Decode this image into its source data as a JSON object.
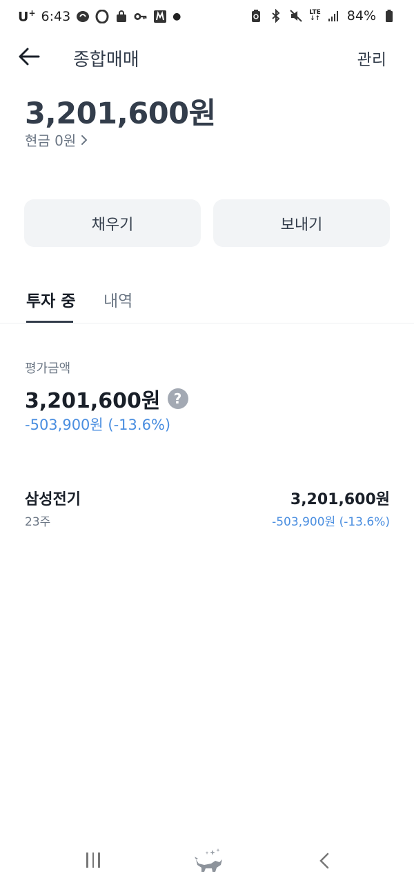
{
  "status_bar": {
    "carrier": "U",
    "carrier_sup": "+",
    "time": "6:43",
    "battery": "84%",
    "network": "LTE"
  },
  "header": {
    "title": "종합매매",
    "manage_label": "관리"
  },
  "balance": {
    "amount": "3,201,600원",
    "cash_label": "현금 0원"
  },
  "actions": {
    "fill_label": "채우기",
    "send_label": "보내기"
  },
  "tabs": [
    {
      "label": "투자 중",
      "active": true
    },
    {
      "label": "내역",
      "active": false
    }
  ],
  "evaluation": {
    "label": "평가금액",
    "amount": "3,201,600원",
    "change": "-503,900원 (-13.6%)"
  },
  "holdings": [
    {
      "name": "삼성전기",
      "quantity": "23주",
      "value": "3,201,600원",
      "change": "-503,900원 (-13.6%)"
    }
  ],
  "colors": {
    "loss_blue": "#4a8ee0",
    "button_bg": "#f2f4f6",
    "text_primary": "#191f28",
    "text_secondary": "#6b7684"
  }
}
